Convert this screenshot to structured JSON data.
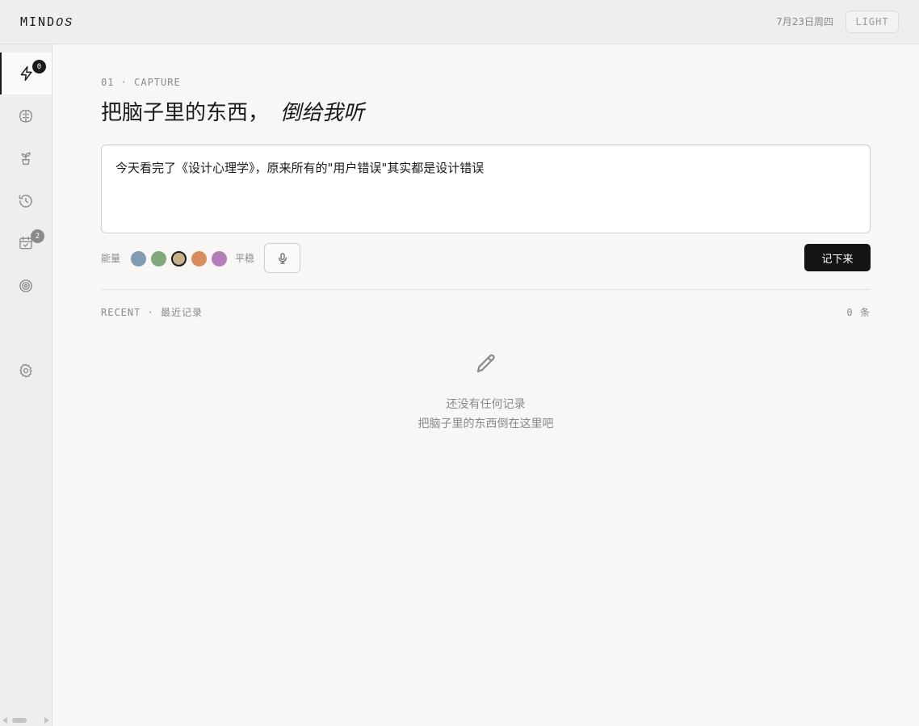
{
  "header": {
    "logo_main": "MIND",
    "logo_italic": "OS",
    "date": "7月23日周四",
    "theme_label": "LIGHT"
  },
  "sidebar": {
    "items": [
      {
        "icon": "lightning-icon",
        "badge": "0",
        "active": true
      },
      {
        "icon": "brain-icon"
      },
      {
        "icon": "sprout-icon"
      },
      {
        "icon": "history-icon"
      },
      {
        "icon": "calendar-check-icon",
        "badge": "2"
      },
      {
        "icon": "target-icon"
      },
      {
        "icon": "gear-icon"
      }
    ]
  },
  "capture": {
    "section_label": "01 · CAPTURE",
    "headline": "把脑子里的东西，",
    "headline_italic": "倒给我听",
    "input_value": "今天看完了《设计心理学》，原来所有的\"用户错误\"其实都是设计错误",
    "energy_label": "能量",
    "energy_colors": [
      "#7f9cb3",
      "#80a878",
      "#c9b08a",
      "#d98d5c",
      "#b47db8"
    ],
    "energy_selected_index": 2,
    "energy_value": "平稳",
    "save_label": "记下来"
  },
  "recent": {
    "label": "RECENT · 最近记录",
    "count": "0 条",
    "empty_title": "还没有任何记录",
    "empty_sub": "把脑子里的东西倒在这里吧"
  }
}
